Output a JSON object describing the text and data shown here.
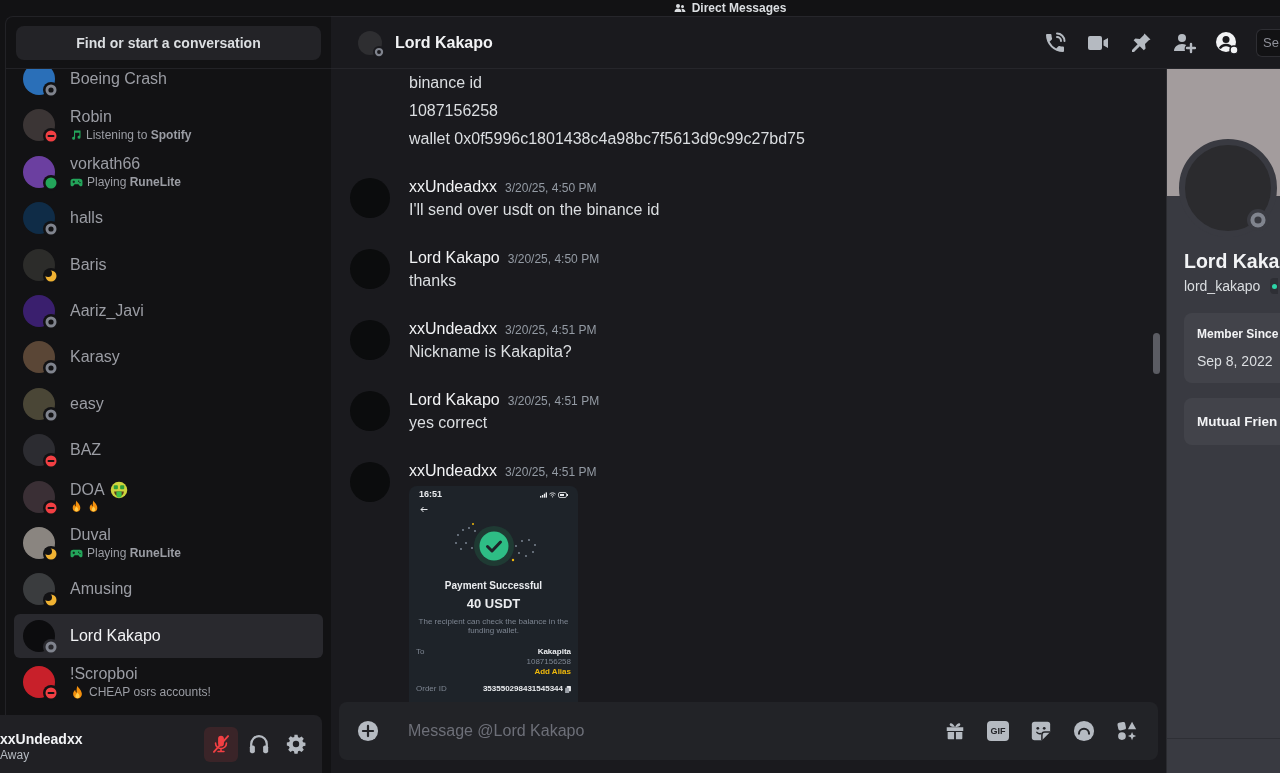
{
  "window": {
    "title": "Direct Messages"
  },
  "sidebar": {
    "search_button": "Find or start a conversation",
    "conversations": [
      {
        "name": "Boeing Crash",
        "presence": {
          "kind": "offline"
        },
        "selected": false
      },
      {
        "name": "Robin",
        "presence": {
          "kind": "dnd"
        },
        "selected": false,
        "activity": {
          "kind": "listening",
          "text": "Listening to **Spotify**"
        }
      },
      {
        "name": "vorkath66",
        "presence": {
          "kind": "online"
        },
        "selected": false,
        "activity": {
          "kind": "playing",
          "text": "Playing **RuneLite**"
        }
      },
      {
        "name": "halls",
        "presence": {
          "kind": "offline"
        },
        "selected": false
      },
      {
        "name": "Baris",
        "presence": {
          "kind": "idle"
        },
        "selected": false
      },
      {
        "name": "Aariz_Javi",
        "presence": {
          "kind": "offline"
        },
        "selected": false
      },
      {
        "name": "Karasy",
        "presence": {
          "kind": "offline"
        },
        "selected": false
      },
      {
        "name": "easy",
        "presence": {
          "kind": "offline"
        },
        "selected": false
      },
      {
        "name": "BAZ",
        "presence": {
          "kind": "dnd"
        },
        "selected": false
      },
      {
        "name": "DOA",
        "name_emoji": {
          "kind": "money_mouth"
        },
        "presence": {
          "kind": "dnd"
        },
        "selected": false,
        "activity": {
          "kind": "custom",
          "emojis": [
            {
              "kind": "fire"
            },
            {
              "kind": "fire"
            }
          ]
        }
      },
      {
        "name": "Duval",
        "presence": {
          "kind": "idle"
        },
        "selected": false,
        "activity": {
          "kind": "playing",
          "text": "Playing **RuneLite**"
        }
      },
      {
        "name": "Amusing",
        "presence": {
          "kind": "idle"
        },
        "selected": false
      },
      {
        "name": "Lord Kakapo",
        "presence": {
          "kind": "offline"
        },
        "selected": true
      },
      {
        "name": "!Scropboi",
        "presence": {
          "kind": "dnd"
        },
        "selected": false,
        "activity": {
          "kind": "custom",
          "emojis": [
            {
              "kind": "fire"
            }
          ],
          "text": "CHEAP osrs accounts!"
        }
      }
    ]
  },
  "user_panel": {
    "name": "xxUndeadxx",
    "status_text": "Away",
    "controls": [
      {
        "kind": "microphone",
        "on": false
      },
      {
        "kind": "headphones",
        "on": true
      },
      {
        "kind": "settings"
      }
    ]
  },
  "header": {
    "title": "Lord Kakapo",
    "presence": {
      "kind": "offline"
    },
    "toolbar": [
      {
        "kind": "call",
        "on": false
      },
      {
        "kind": "video",
        "on": false
      },
      {
        "kind": "pins",
        "on": false
      },
      {
        "kind": "add_friends",
        "on": false
      },
      {
        "kind": "profile",
        "on": true
      }
    ],
    "search": {
      "placeholder": "Se"
    }
  },
  "messages": [
    {
      "kind": "line",
      "text": "binance id"
    },
    {
      "kind": "line",
      "text": "1087156258"
    },
    {
      "kind": "line",
      "text": "wallet 0x0f5996c1801438c4a98bc7f5613d9c99c27bd75"
    },
    {
      "kind": "group",
      "author": "xxUndeadxx",
      "time": "3/20/25, 4:50 PM",
      "text": "I'll send over usdt on the binance id"
    },
    {
      "kind": "group",
      "author": "Lord Kakapo",
      "time": "3/20/25, 4:50 PM",
      "text": "thanks"
    },
    {
      "kind": "group",
      "author": "xxUndeadxx",
      "time": "3/20/25, 4:51 PM",
      "text": "Nickname is Kakapita?"
    },
    {
      "kind": "group",
      "author": "Lord Kakapo",
      "time": "3/20/25, 4:51 PM",
      "text": "yes correct"
    },
    {
      "kind": "group",
      "author": "xxUndeadxx",
      "time": "3/20/25, 4:51 PM",
      "attachment": {
        "kind": "payment_screenshot",
        "clock": "16:51",
        "title": "Payment Successful",
        "amount": "40 USDT",
        "note": "The recipient can check the balance in the funding wallet.",
        "details": [
          {
            "label": "To",
            "value": "Kakapita",
            "sub": "1087156258",
            "link": "Add Alias",
            "copyable": false
          },
          {
            "label": "Order ID",
            "value": "353550298431545344",
            "copyable": true
          }
        ]
      }
    }
  ],
  "composer": {
    "placeholder": "Message @Lord Kakapo",
    "tools": [
      {
        "kind": "gift"
      },
      {
        "kind": "gif",
        "label": "GIF"
      },
      {
        "kind": "sticker"
      },
      {
        "kind": "emoji"
      },
      {
        "kind": "apps"
      }
    ]
  },
  "profile": {
    "display_name": "Lord Kaka",
    "username": "lord_kakapo",
    "presence": {
      "kind": "offline"
    },
    "cards": [
      {
        "title": "Member Since",
        "value": "Sep 8, 2022"
      },
      {
        "title": "Mutual Frien"
      }
    ]
  }
}
